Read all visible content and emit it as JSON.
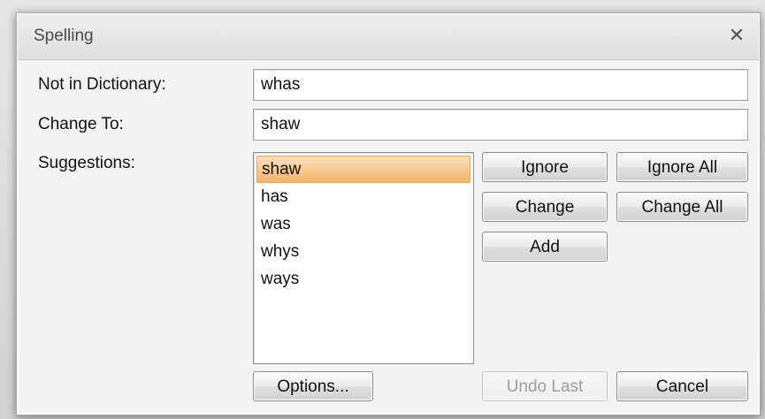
{
  "window": {
    "title": "Spelling",
    "close_glyph": "✕"
  },
  "form": {
    "not_in_dictionary_label": "Not in Dictionary:",
    "not_in_dictionary_value": "whas",
    "change_to_label": "Change To:",
    "change_to_value": "shaw",
    "suggestions_label": "Suggestions:"
  },
  "suggestions": {
    "items": [
      {
        "label": "shaw",
        "selected": true
      },
      {
        "label": "has",
        "selected": false
      },
      {
        "label": "was",
        "selected": false
      },
      {
        "label": "whys",
        "selected": false
      },
      {
        "label": "ways",
        "selected": false
      }
    ]
  },
  "buttons": {
    "ignore": "Ignore",
    "ignore_all": "Ignore All",
    "change": "Change",
    "change_all": "Change All",
    "add": "Add",
    "options": "Options...",
    "undo_last": "Undo Last",
    "cancel": "Cancel"
  },
  "colors": {
    "selection": "#f8c88c",
    "disabled_text": "#9e9e9e"
  }
}
